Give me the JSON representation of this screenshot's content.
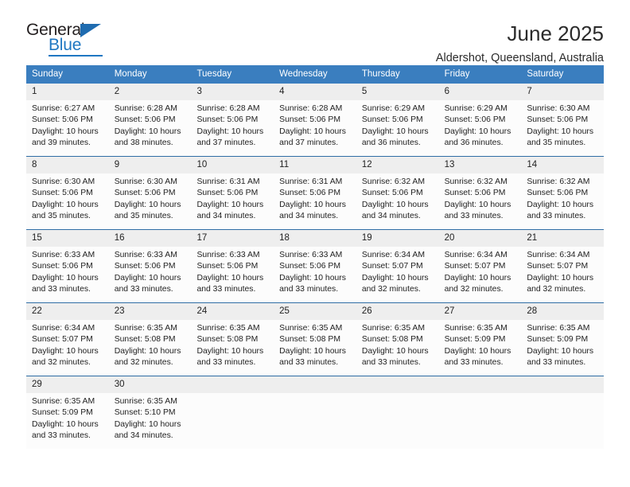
{
  "logo": {
    "word_one": "General",
    "word_two": "Blue",
    "triangle_color": "#1f6cb0",
    "blue_color": "#1f77c2"
  },
  "header": {
    "title": "June 2025",
    "subtitle": "Aldershot, Queensland, Australia"
  },
  "theme": {
    "header_blue": "#3a7ebf",
    "rule_blue": "#2f6ea5",
    "date_band_gray": "#eeeeee"
  },
  "weekdays": [
    "Sunday",
    "Monday",
    "Tuesday",
    "Wednesday",
    "Thursday",
    "Friday",
    "Saturday"
  ],
  "weeks": [
    {
      "days": [
        {
          "date": "1",
          "sunrise": "Sunrise: 6:27 AM",
          "sunset": "Sunset: 5:06 PM",
          "daylight_1": "Daylight: 10 hours",
          "daylight_2": "and 39 minutes."
        },
        {
          "date": "2",
          "sunrise": "Sunrise: 6:28 AM",
          "sunset": "Sunset: 5:06 PM",
          "daylight_1": "Daylight: 10 hours",
          "daylight_2": "and 38 minutes."
        },
        {
          "date": "3",
          "sunrise": "Sunrise: 6:28 AM",
          "sunset": "Sunset: 5:06 PM",
          "daylight_1": "Daylight: 10 hours",
          "daylight_2": "and 37 minutes."
        },
        {
          "date": "4",
          "sunrise": "Sunrise: 6:28 AM",
          "sunset": "Sunset: 5:06 PM",
          "daylight_1": "Daylight: 10 hours",
          "daylight_2": "and 37 minutes."
        },
        {
          "date": "5",
          "sunrise": "Sunrise: 6:29 AM",
          "sunset": "Sunset: 5:06 PM",
          "daylight_1": "Daylight: 10 hours",
          "daylight_2": "and 36 minutes."
        },
        {
          "date": "6",
          "sunrise": "Sunrise: 6:29 AM",
          "sunset": "Sunset: 5:06 PM",
          "daylight_1": "Daylight: 10 hours",
          "daylight_2": "and 36 minutes."
        },
        {
          "date": "7",
          "sunrise": "Sunrise: 6:30 AM",
          "sunset": "Sunset: 5:06 PM",
          "daylight_1": "Daylight: 10 hours",
          "daylight_2": "and 35 minutes."
        }
      ]
    },
    {
      "days": [
        {
          "date": "8",
          "sunrise": "Sunrise: 6:30 AM",
          "sunset": "Sunset: 5:06 PM",
          "daylight_1": "Daylight: 10 hours",
          "daylight_2": "and 35 minutes."
        },
        {
          "date": "9",
          "sunrise": "Sunrise: 6:30 AM",
          "sunset": "Sunset: 5:06 PM",
          "daylight_1": "Daylight: 10 hours",
          "daylight_2": "and 35 minutes."
        },
        {
          "date": "10",
          "sunrise": "Sunrise: 6:31 AM",
          "sunset": "Sunset: 5:06 PM",
          "daylight_1": "Daylight: 10 hours",
          "daylight_2": "and 34 minutes."
        },
        {
          "date": "11",
          "sunrise": "Sunrise: 6:31 AM",
          "sunset": "Sunset: 5:06 PM",
          "daylight_1": "Daylight: 10 hours",
          "daylight_2": "and 34 minutes."
        },
        {
          "date": "12",
          "sunrise": "Sunrise: 6:32 AM",
          "sunset": "Sunset: 5:06 PM",
          "daylight_1": "Daylight: 10 hours",
          "daylight_2": "and 34 minutes."
        },
        {
          "date": "13",
          "sunrise": "Sunrise: 6:32 AM",
          "sunset": "Sunset: 5:06 PM",
          "daylight_1": "Daylight: 10 hours",
          "daylight_2": "and 33 minutes."
        },
        {
          "date": "14",
          "sunrise": "Sunrise: 6:32 AM",
          "sunset": "Sunset: 5:06 PM",
          "daylight_1": "Daylight: 10 hours",
          "daylight_2": "and 33 minutes."
        }
      ]
    },
    {
      "days": [
        {
          "date": "15",
          "sunrise": "Sunrise: 6:33 AM",
          "sunset": "Sunset: 5:06 PM",
          "daylight_1": "Daylight: 10 hours",
          "daylight_2": "and 33 minutes."
        },
        {
          "date": "16",
          "sunrise": "Sunrise: 6:33 AM",
          "sunset": "Sunset: 5:06 PM",
          "daylight_1": "Daylight: 10 hours",
          "daylight_2": "and 33 minutes."
        },
        {
          "date": "17",
          "sunrise": "Sunrise: 6:33 AM",
          "sunset": "Sunset: 5:06 PM",
          "daylight_1": "Daylight: 10 hours",
          "daylight_2": "and 33 minutes."
        },
        {
          "date": "18",
          "sunrise": "Sunrise: 6:33 AM",
          "sunset": "Sunset: 5:06 PM",
          "daylight_1": "Daylight: 10 hours",
          "daylight_2": "and 33 minutes."
        },
        {
          "date": "19",
          "sunrise": "Sunrise: 6:34 AM",
          "sunset": "Sunset: 5:07 PM",
          "daylight_1": "Daylight: 10 hours",
          "daylight_2": "and 32 minutes."
        },
        {
          "date": "20",
          "sunrise": "Sunrise: 6:34 AM",
          "sunset": "Sunset: 5:07 PM",
          "daylight_1": "Daylight: 10 hours",
          "daylight_2": "and 32 minutes."
        },
        {
          "date": "21",
          "sunrise": "Sunrise: 6:34 AM",
          "sunset": "Sunset: 5:07 PM",
          "daylight_1": "Daylight: 10 hours",
          "daylight_2": "and 32 minutes."
        }
      ]
    },
    {
      "days": [
        {
          "date": "22",
          "sunrise": "Sunrise: 6:34 AM",
          "sunset": "Sunset: 5:07 PM",
          "daylight_1": "Daylight: 10 hours",
          "daylight_2": "and 32 minutes."
        },
        {
          "date": "23",
          "sunrise": "Sunrise: 6:35 AM",
          "sunset": "Sunset: 5:08 PM",
          "daylight_1": "Daylight: 10 hours",
          "daylight_2": "and 32 minutes."
        },
        {
          "date": "24",
          "sunrise": "Sunrise: 6:35 AM",
          "sunset": "Sunset: 5:08 PM",
          "daylight_1": "Daylight: 10 hours",
          "daylight_2": "and 33 minutes."
        },
        {
          "date": "25",
          "sunrise": "Sunrise: 6:35 AM",
          "sunset": "Sunset: 5:08 PM",
          "daylight_1": "Daylight: 10 hours",
          "daylight_2": "and 33 minutes."
        },
        {
          "date": "26",
          "sunrise": "Sunrise: 6:35 AM",
          "sunset": "Sunset: 5:08 PM",
          "daylight_1": "Daylight: 10 hours",
          "daylight_2": "and 33 minutes."
        },
        {
          "date": "27",
          "sunrise": "Sunrise: 6:35 AM",
          "sunset": "Sunset: 5:09 PM",
          "daylight_1": "Daylight: 10 hours",
          "daylight_2": "and 33 minutes."
        },
        {
          "date": "28",
          "sunrise": "Sunrise: 6:35 AM",
          "sunset": "Sunset: 5:09 PM",
          "daylight_1": "Daylight: 10 hours",
          "daylight_2": "and 33 minutes."
        }
      ]
    },
    {
      "days": [
        {
          "date": "29",
          "sunrise": "Sunrise: 6:35 AM",
          "sunset": "Sunset: 5:09 PM",
          "daylight_1": "Daylight: 10 hours",
          "daylight_2": "and 33 minutes."
        },
        {
          "date": "30",
          "sunrise": "Sunrise: 6:35 AM",
          "sunset": "Sunset: 5:10 PM",
          "daylight_1": "Daylight: 10 hours",
          "daylight_2": "and 34 minutes."
        },
        {
          "date": "",
          "sunrise": "",
          "sunset": "",
          "daylight_1": "",
          "daylight_2": ""
        },
        {
          "date": "",
          "sunrise": "",
          "sunset": "",
          "daylight_1": "",
          "daylight_2": ""
        },
        {
          "date": "",
          "sunrise": "",
          "sunset": "",
          "daylight_1": "",
          "daylight_2": ""
        },
        {
          "date": "",
          "sunrise": "",
          "sunset": "",
          "daylight_1": "",
          "daylight_2": ""
        },
        {
          "date": "",
          "sunrise": "",
          "sunset": "",
          "daylight_1": "",
          "daylight_2": ""
        }
      ]
    }
  ]
}
